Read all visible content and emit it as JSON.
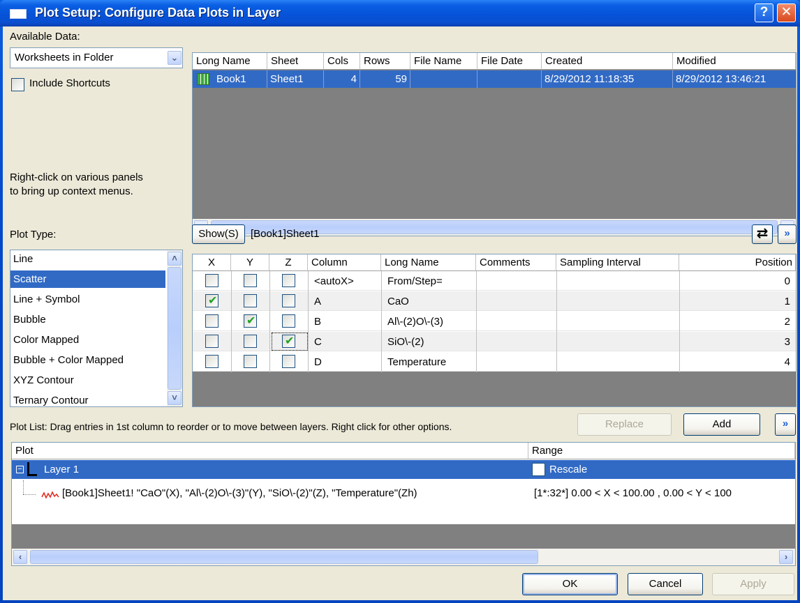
{
  "window": {
    "title": "Plot Setup: Configure Data Plots in Layer",
    "help": "?",
    "close": "✕"
  },
  "available_data": {
    "label": "Available Data:",
    "selected": "Worksheets in Folder",
    "include_shortcuts": "Include Shortcuts",
    "hint": [
      "Right-click on various panels",
      "to bring up context menus."
    ]
  },
  "book_table": {
    "headers": [
      "Long Name",
      "Sheet",
      "Cols",
      "Rows",
      "File Name",
      "File Date",
      "Created",
      "Modified"
    ],
    "rows": [
      {
        "long_name": "Book1",
        "sheet": "Sheet1",
        "cols": "4",
        "rows": "59",
        "file_name": "",
        "file_date": "",
        "created": "8/29/2012 11:18:35",
        "modified": "8/29/2012 13:46:21"
      }
    ]
  },
  "plot_type": {
    "label": "Plot Type:",
    "items": [
      "Line",
      "Scatter",
      "Line + Symbol",
      "Bubble",
      "Color Mapped",
      "Bubble + Color Mapped",
      "XYZ Contour",
      "Ternary Contour"
    ],
    "selected_index": 1
  },
  "show_button": "Show(S)",
  "sheet_label": "[Book1]Sheet1",
  "column_table": {
    "headers": [
      "X",
      "Y",
      "Z",
      "Column",
      "Long Name",
      "Comments",
      "Sampling Interval",
      "Position"
    ],
    "rows": [
      {
        "x": false,
        "y": false,
        "z": false,
        "column": "<autoX>",
        "long_name": "From/Step=",
        "comments": "",
        "sampling": "",
        "position": "0"
      },
      {
        "x": true,
        "y": false,
        "z": false,
        "column": "A",
        "long_name": "CaO",
        "comments": "",
        "sampling": "",
        "position": "1"
      },
      {
        "x": false,
        "y": true,
        "z": false,
        "column": "B",
        "long_name": "Al\\-(2)O\\-(3)",
        "comments": "",
        "sampling": "",
        "position": "2"
      },
      {
        "x": false,
        "y": false,
        "z": true,
        "column": "C",
        "long_name": "SiO\\-(2)",
        "comments": "",
        "sampling": "",
        "position": "3"
      },
      {
        "x": false,
        "y": false,
        "z": false,
        "column": "D",
        "long_name": "Temperature",
        "comments": "",
        "sampling": "",
        "position": "4"
      }
    ]
  },
  "plot_list": {
    "caption": "Plot List: Drag entries in 1st column to reorder or to move between layers. Right click for other options.",
    "replace": "Replace",
    "add": "Add",
    "headers": [
      "Plot",
      "Range"
    ],
    "layer_label": "Layer 1",
    "rescale": "Rescale",
    "entry": "[Book1]Sheet1! \"CaO\"(X), \"Al\\-(2)O\\-(3)\"(Y), \"SiO\\-(2)\"(Z), \"Temperature\"(Zh)",
    "range": "[1*:32*]  0.00 < X < 100.00 , 0.00 < Y < 100"
  },
  "buttons": {
    "ok": "OK",
    "cancel": "Cancel",
    "apply": "Apply"
  },
  "colors": {
    "selection": "#316ac5",
    "title_blue": "#0653d8",
    "gray_area": "#808080",
    "check_green": "#21a121"
  }
}
